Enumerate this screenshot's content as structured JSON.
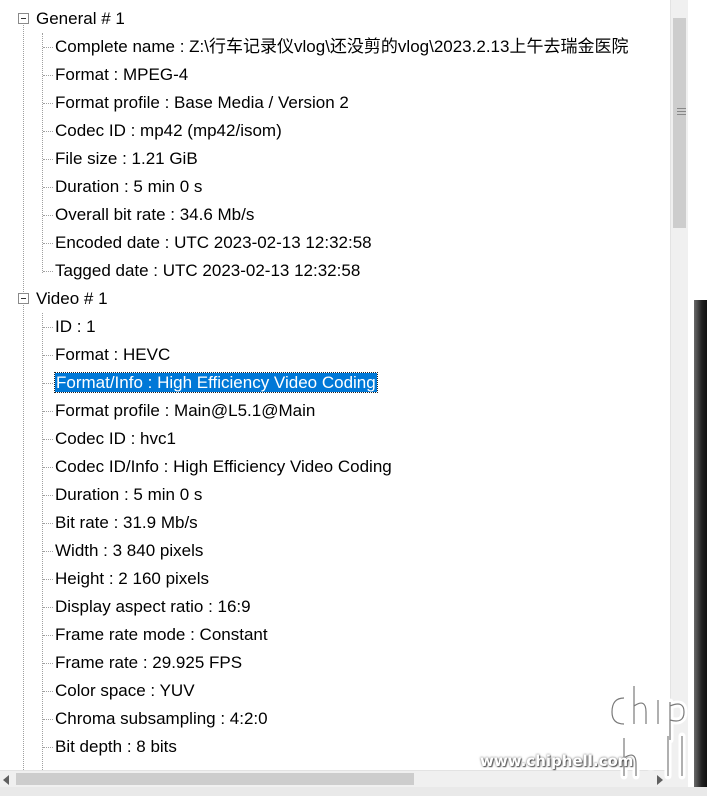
{
  "tree": {
    "top_clipped_text": "",
    "groups": [
      {
        "label": "General # 1",
        "items": [
          "Complete name : Z:\\行车记录仪vlog\\还没剪的vlog\\2023.2.13上午去瑞金医院",
          "Format : MPEG-4",
          "Format profile : Base Media / Version 2",
          "Codec ID : mp42 (mp42/isom)",
          "File size : 1.21 GiB",
          "Duration : 5 min 0 s",
          "Overall bit rate : 34.6 Mb/s",
          "Encoded date : UTC 2023-02-13 12:32:58",
          "Tagged date : UTC 2023-02-13 12:32:58"
        ]
      },
      {
        "label": "Video # 1",
        "items": [
          "ID : 1",
          "Format : HEVC",
          "Format/Info : High Efficiency Video Coding",
          "Format profile : Main@L5.1@Main",
          "Codec ID : hvc1",
          "Codec ID/Info : High Efficiency Video Coding",
          "Duration : 5 min 0 s",
          "Bit rate : 31.9 Mb/s",
          "Width : 3 840 pixels",
          "Height : 2 160 pixels",
          "Display aspect ratio : 16:9",
          "Frame rate mode : Constant",
          "Frame rate : 29.925 FPS",
          "Color space : YUV",
          "Chroma subsampling : 4:2:0",
          "Bit depth : 8 bits"
        ]
      }
    ],
    "selected_item": "Format/Info : High Efficiency Video Coding",
    "selection_color": "#0078d7"
  },
  "watermark": {
    "logo_text": "chip hell",
    "url": "www.chiphell.com"
  }
}
